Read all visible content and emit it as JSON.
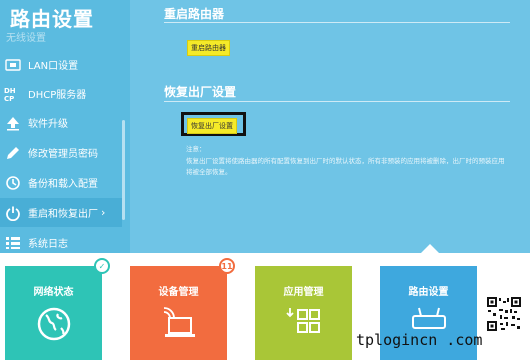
{
  "sidebar": {
    "title": "路由设置",
    "partial_item": "无线设置",
    "items": [
      {
        "label": "LAN口设置",
        "icon": "lan-icon"
      },
      {
        "label": "DHCP服务器",
        "icon": "dhcp-icon"
      },
      {
        "label": "软件升级",
        "icon": "upgrade-icon"
      },
      {
        "label": "修改管理员密码",
        "icon": "pencil-icon"
      },
      {
        "label": "备份和载入配置",
        "icon": "backup-icon"
      },
      {
        "label": "重启和恢复出厂",
        "icon": "power-icon",
        "active": true,
        "arrow": "›"
      },
      {
        "label": "系统日志",
        "icon": "log-icon"
      }
    ]
  },
  "main": {
    "reboot": {
      "title": "重启路由器",
      "button_label": "重启路由器"
    },
    "factory_reset": {
      "title": "恢复出厂设置",
      "button_label": "恢复出厂设置",
      "note_title": "注意：",
      "note_line1": "恢复出厂设置将使路由器的所有配置恢复到出厂时的默认状态，所有非预装的应用将被删除，出厂时的预装应用",
      "note_line2": "将被全部恢复。"
    }
  },
  "bottom_nav": {
    "tiles": [
      {
        "label": "网络状态",
        "color": "#2ec4b6",
        "icon": "globe-icon",
        "badge": "✓"
      },
      {
        "label": "设备管理",
        "color": "#f26c3f",
        "icon": "laptop-wifi-icon",
        "badge": "11"
      },
      {
        "label": "应用管理",
        "color": "#a9c637",
        "icon": "apps-grid-icon"
      },
      {
        "label": "路由设置",
        "color": "#3ea8de",
        "icon": "router-settings-icon"
      }
    ]
  },
  "watermark": "tplogincn .com",
  "colors": {
    "sidebar_bg": "#5bbbe0",
    "main_bg": "#6fc4e6",
    "button_yellow": "#f5ea28",
    "highlight_border": "#111111"
  }
}
